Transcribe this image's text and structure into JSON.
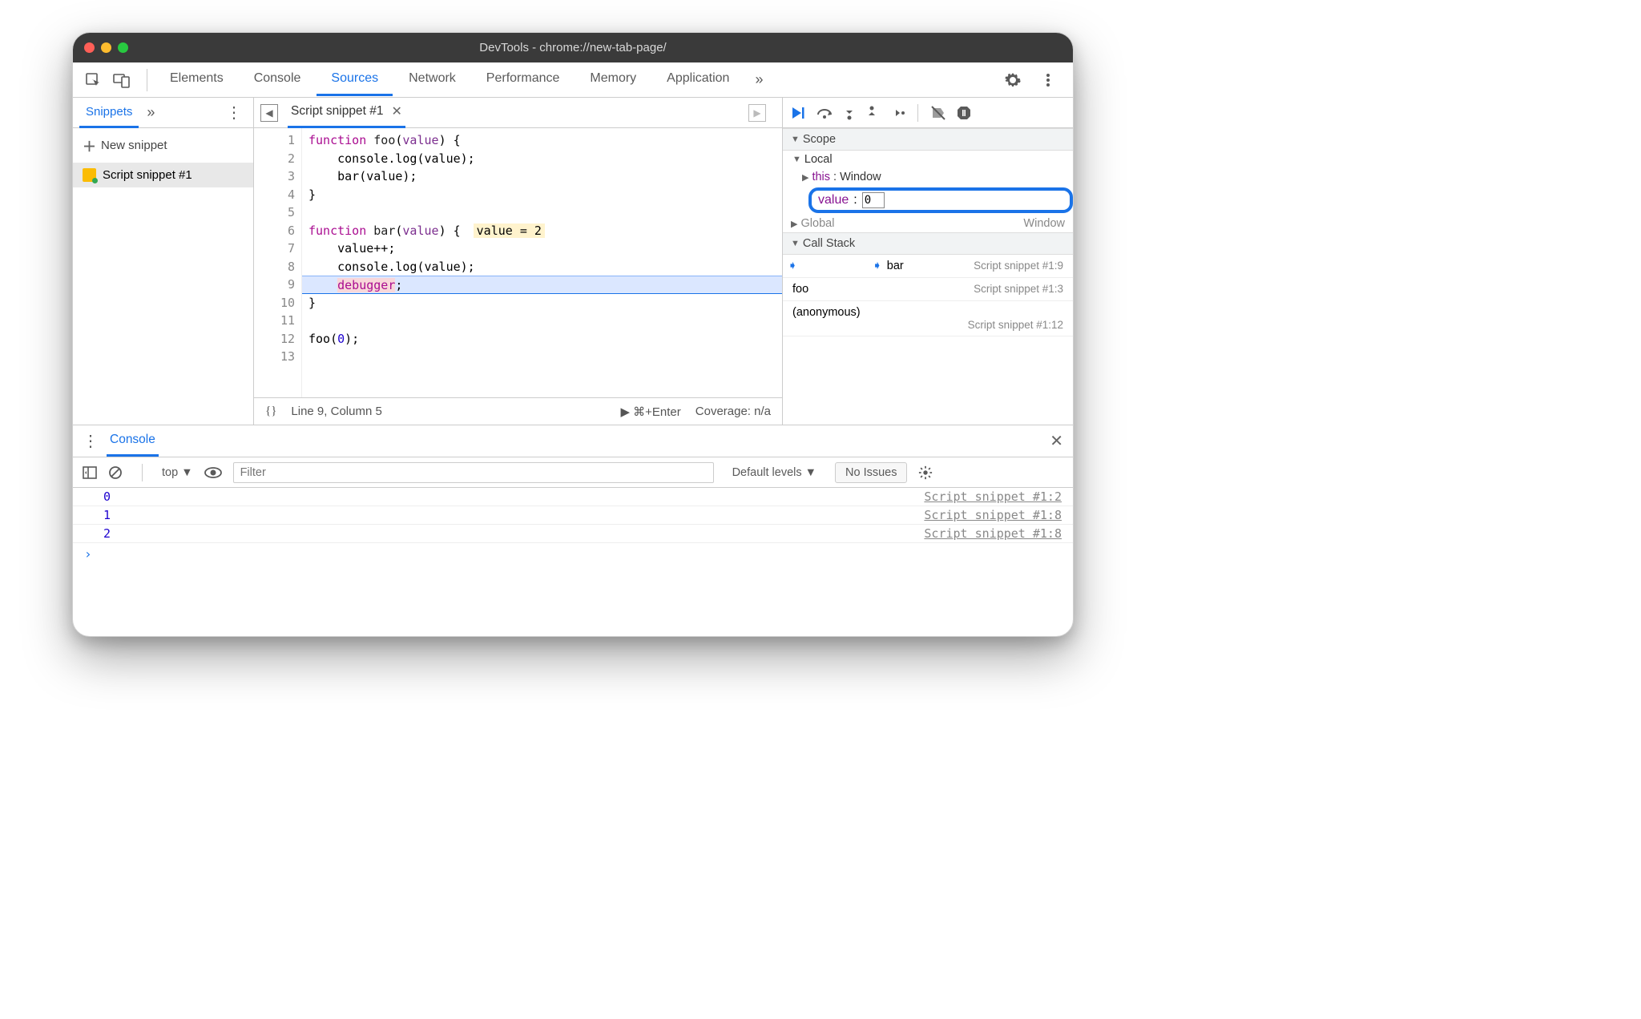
{
  "window": {
    "title": "DevTools - chrome://new-tab-page/"
  },
  "topTabs": {
    "elements": "Elements",
    "console": "Console",
    "sources": "Sources",
    "network": "Network",
    "performance": "Performance",
    "memory": "Memory",
    "application": "Application"
  },
  "navigator": {
    "tab": "Snippets",
    "newSnippet": "New snippet",
    "items": [
      {
        "label": "Script snippet #1"
      }
    ]
  },
  "editor": {
    "tab": "Script snippet #1",
    "lines": [
      {
        "n": 1,
        "html": "<span class='kw'>function</span> <span class='fn'>foo</span>(<span class='prm'>value</span>) {"
      },
      {
        "n": 2,
        "html": "    console.log(value);"
      },
      {
        "n": 3,
        "html": "    bar(value);"
      },
      {
        "n": 4,
        "html": "}"
      },
      {
        "n": 5,
        "html": ""
      },
      {
        "n": 6,
        "html": "<span class='kw'>function</span> <span class='fn'>bar</span>(<span class='prm'>value</span>) {",
        "hint": "value = 2"
      },
      {
        "n": 7,
        "html": "    value++;"
      },
      {
        "n": 8,
        "html": "    console.log(value);"
      },
      {
        "n": 9,
        "html": "    <span class='kw dbg'>debugger</span>;",
        "current": true
      },
      {
        "n": 10,
        "html": "}"
      },
      {
        "n": 11,
        "html": ""
      },
      {
        "n": 12,
        "html": "foo(<span class='num'>0</span>);"
      },
      {
        "n": 13,
        "html": ""
      }
    ],
    "status": {
      "cursor": "Line 9, Column 5",
      "run": "⌘+Enter",
      "coverage": "Coverage: n/a"
    }
  },
  "debugger": {
    "scopeHeader": "Scope",
    "localHeader": "Local",
    "thisLabel": "this",
    "thisValue": "Window",
    "valueLabel": "value",
    "valueEditing": "0",
    "globalLabel": "Global",
    "globalValue": "Window",
    "callStackHeader": "Call Stack",
    "stack": [
      {
        "fn": "bar",
        "loc": "Script snippet #1:9",
        "current": true
      },
      {
        "fn": "foo",
        "loc": "Script snippet #1:3"
      },
      {
        "fn": "(anonymous)",
        "loc": "Script snippet #1:12",
        "wrap": true
      }
    ]
  },
  "consoleDrawer": {
    "tab": "Console",
    "context": "top",
    "filterPlaceholder": "Filter",
    "levels": "Default levels",
    "noIssues": "No Issues",
    "logs": [
      {
        "value": "0",
        "src": "Script snippet #1:2"
      },
      {
        "value": "1",
        "src": "Script snippet #1:8"
      },
      {
        "value": "2",
        "src": "Script snippet #1:8"
      }
    ]
  }
}
